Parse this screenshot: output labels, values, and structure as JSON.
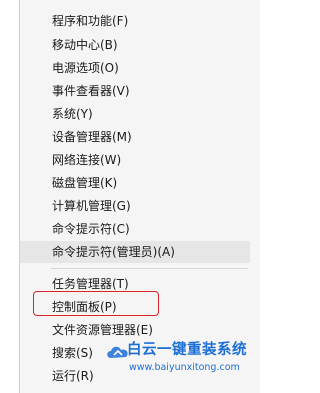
{
  "menu": {
    "items": [
      {
        "label": "程序和功能(F)"
      },
      {
        "label": "移动中心(B)"
      },
      {
        "label": "电源选项(O)"
      },
      {
        "label": "事件查看器(V)"
      },
      {
        "label": "系统(Y)"
      },
      {
        "label": "设备管理器(M)"
      },
      {
        "label": "网络连接(W)"
      },
      {
        "label": "磁盘管理(K)"
      },
      {
        "label": "计算机管理(G)"
      },
      {
        "label": "命令提示符(C)"
      },
      {
        "label": "命令提示符(管理员)(A)"
      },
      {
        "label": "任务管理器(T)"
      },
      {
        "label": "控制面板(P)"
      },
      {
        "label": "文件资源管理器(E)"
      },
      {
        "label": "搜索(S)"
      },
      {
        "label": "运行(R)"
      }
    ]
  },
  "watermark": {
    "title": "白云一键重装系统",
    "url": "www.baiyunxitong.com"
  },
  "colors": {
    "highlight_box": "#d9242a",
    "watermark": "#1d6fd6"
  }
}
